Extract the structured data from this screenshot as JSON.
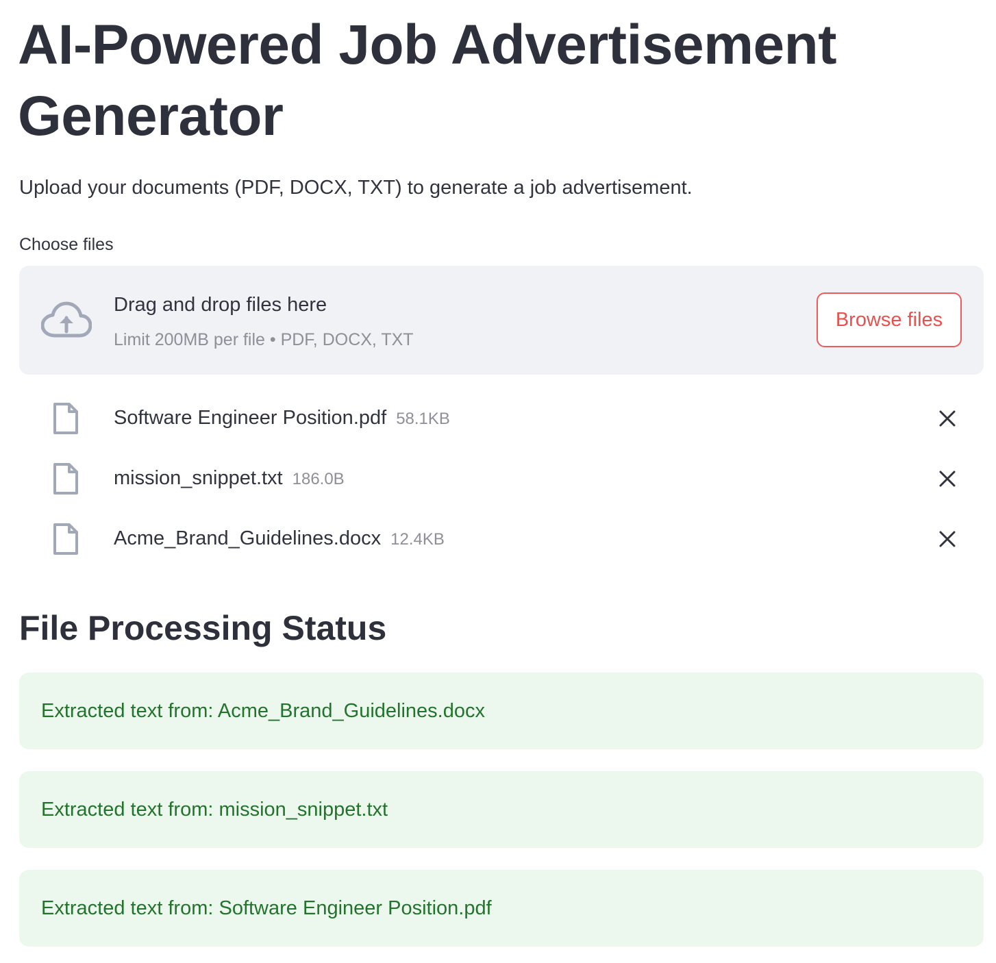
{
  "header": {
    "title": "AI-Powered Job Advertisement Generator",
    "subtitle": "Upload your documents (PDF, DOCX, TXT) to generate a job advertisement."
  },
  "uploader": {
    "label": "Choose files",
    "dropzone_title": "Drag and drop files here",
    "dropzone_hint": "Limit 200MB per file • PDF, DOCX, TXT",
    "browse_label": "Browse files",
    "upload_icon": "cloud-upload-icon"
  },
  "files": [
    {
      "name": "Software Engineer Position.pdf",
      "size": "58.1KB"
    },
    {
      "name": "mission_snippet.txt",
      "size": "186.0B"
    },
    {
      "name": "Acme_Brand_Guidelines.docx",
      "size": "12.4KB"
    }
  ],
  "status": {
    "title": "File Processing Status",
    "messages": [
      "Extracted text from: Acme_Brand_Guidelines.docx",
      "Extracted text from: mission_snippet.txt",
      "Extracted text from: Software Engineer Position.pdf"
    ]
  },
  "colors": {
    "accent": "#ec5b5b",
    "success_bg": "#ecf8ee",
    "success_text": "#22742d",
    "dropzone_bg": "#f0f2f6"
  }
}
